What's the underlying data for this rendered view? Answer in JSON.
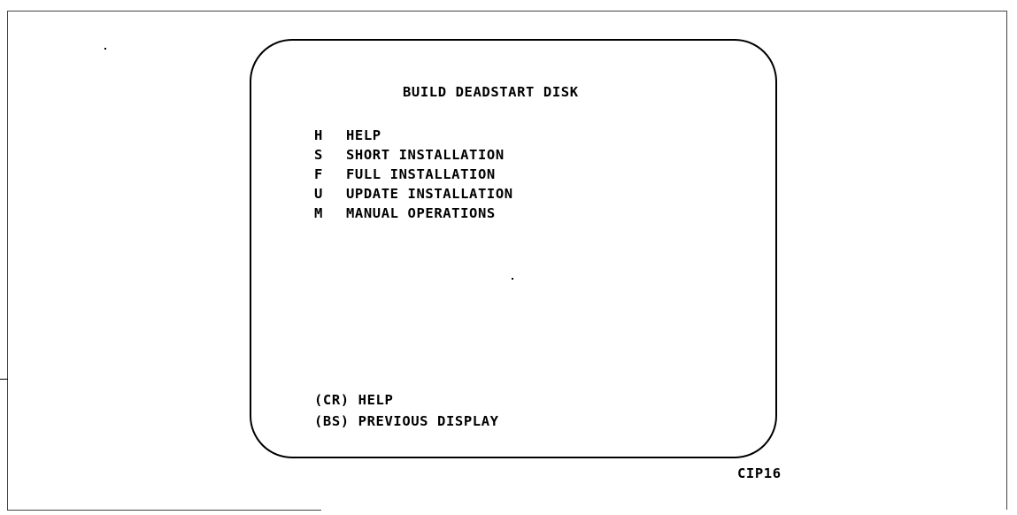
{
  "screen": {
    "title": "BUILD DEADSTART DISK",
    "menu_items": [
      {
        "key": "H",
        "label": "HELP"
      },
      {
        "key": "S",
        "label": "SHORT INSTALLATION"
      },
      {
        "key": "F",
        "label": "FULL INSTALLATION"
      },
      {
        "key": "U",
        "label": "UPDATE INSTALLATION"
      },
      {
        "key": "M",
        "label": "MANUAL OPERATIONS"
      }
    ],
    "footer": {
      "cr_help": "(CR) HELP",
      "bs_previous": "(BS) PREVIOUS DISPLAY"
    }
  },
  "figure_id": "CIP16"
}
